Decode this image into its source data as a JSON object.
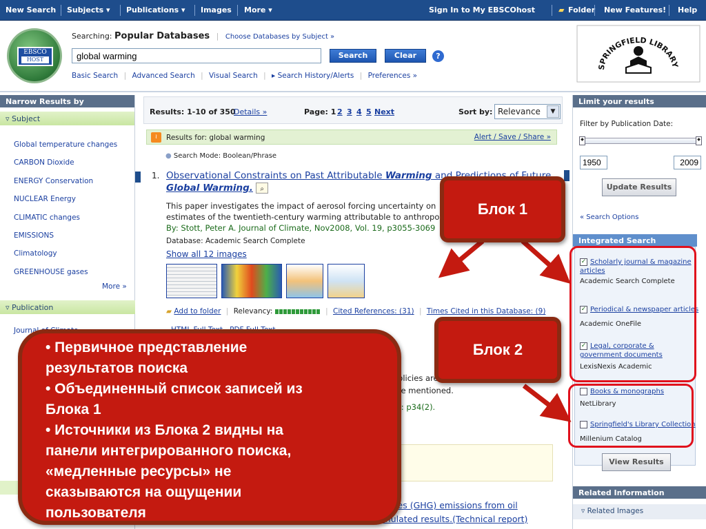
{
  "topnav": {
    "new_search": "New Search",
    "subjects": "Subjects ▾",
    "publications": "Publications ▾",
    "images": "Images",
    "more": "More ▾",
    "sign_in": "Sign In to My EBSCOhost",
    "folder": "Folder",
    "new_features": "New Features!",
    "help": "Help"
  },
  "header": {
    "logo_top": "EBSCO",
    "logo_bottom": "HOST",
    "searching_label": "Searching:",
    "database": "Popular Databases",
    "choose_link": "Choose Databases by Subject »",
    "query": "global warming",
    "search_btn": "Search",
    "clear_btn": "Clear",
    "help_glyph": "?",
    "links": [
      "Basic Search",
      "Advanced Search",
      "Visual Search",
      "▸ Search History/Alerts",
      "Preferences »"
    ],
    "library_text": "SPRINGFIELD LIBRARY SYSTEM"
  },
  "left": {
    "narrow_title": "Narrow Results by",
    "subject_label": "▿ Subject",
    "subjects": [
      "Global temperature changes",
      "CARBON Dioxide",
      "ENERGY Conservation",
      "NUCLEAR Energy",
      "CLIMATIC changes",
      "EMISSIONS",
      "Climatology",
      "GREENHOUSE gases"
    ],
    "more": "More »",
    "publication_label": "▿ Publication",
    "pub_item": "Journal of Climate"
  },
  "results": {
    "range": "Results: 1-10 of 350",
    "details": "Details »",
    "page_label": "Page: 1",
    "pages": [
      "2",
      "3",
      "4",
      "5"
    ],
    "next": "Next",
    "sort_label": "Sort by:",
    "sort_value": "Relevance",
    "results_for": "Results for: global warming",
    "alert_link": "Alert / Save / Share »",
    "search_mode": "Search Mode: Boolean/Phrase",
    "item_num": "1.",
    "title_a": "Observational Constraints on Past Attributable ",
    "title_b": "Warming",
    "title_c": " and Predictions of Future ",
    "title_d": "Global Warming.",
    "abstract1": "This paper investigates the impact of aerosol forcing uncertainty on",
    "abstract2": "estimates of the twentieth-century warming attributable to anthropo",
    "by_line": "By: Stott, Peter A. Journal of Climate, Nov2008, Vol. 19, p3055-3069",
    "database": "Database: Academic Search Complete",
    "show_images": "Show all 12 images",
    "add_folder": "Add to folder",
    "relevancy": "Relevancy:",
    "cited": "Cited References: (31)",
    "times_cited": "Times Cited in this Database: (9)",
    "frag1": "HTML Full Text",
    "frag2": "PDF Full Text",
    "frag3": "policies are discussed. The American",
    "frag4": "are mentioned.",
    "frag5": "3): p34(2).",
    "next_title1": "ses (GHG) emissions from oil",
    "next_title2": "production facilities at northern Kuwait oilfields: simulated results.(Technical report)"
  },
  "right": {
    "limit_title": "Limit your results",
    "filter_label": "Filter by Publication Date:",
    "date_from": "1950",
    "date_to": "2009",
    "update_btn": "Update Results",
    "search_options": "« Search Options",
    "integrated_title": "Integrated Search",
    "sources": [
      {
        "label": "Scholarly journal & magazine articles",
        "sub": "Academic Search Complete",
        "checked": true
      },
      {
        "label": "Periodical & newspaper articles",
        "sub": "Academic OneFile",
        "checked": true
      },
      {
        "label": "Legal, corporate & government documents",
        "sub": "LexisNexis Academic",
        "checked": true
      },
      {
        "label": "Books & monographs",
        "sub": "NetLibrary",
        "checked": false
      },
      {
        "label": "Springfield's Library Collection",
        "sub": "Millenium Catalog",
        "checked": false
      }
    ],
    "view_btn": "View Results",
    "related_title": "Related Information",
    "related_images": "▿ Related Images"
  },
  "callouts": {
    "block1": "Блок 1",
    "block2": "Блок 2",
    "main_lines": [
      "• Первичное представление",
      "результатов поиска",
      "• Объединенный список записей из",
      "Блока 1",
      "• Источники из Блока 2 видны на",
      "панели интегрированного поиска,",
      "«медленные ресурсы» не",
      "сказываются на ощущении",
      "пользователя"
    ]
  },
  "colors": {
    "nav": "#1e4d8c",
    "callout": "#c41a10",
    "callout_border": "#8a2a12",
    "highlight": "#e0101c"
  }
}
